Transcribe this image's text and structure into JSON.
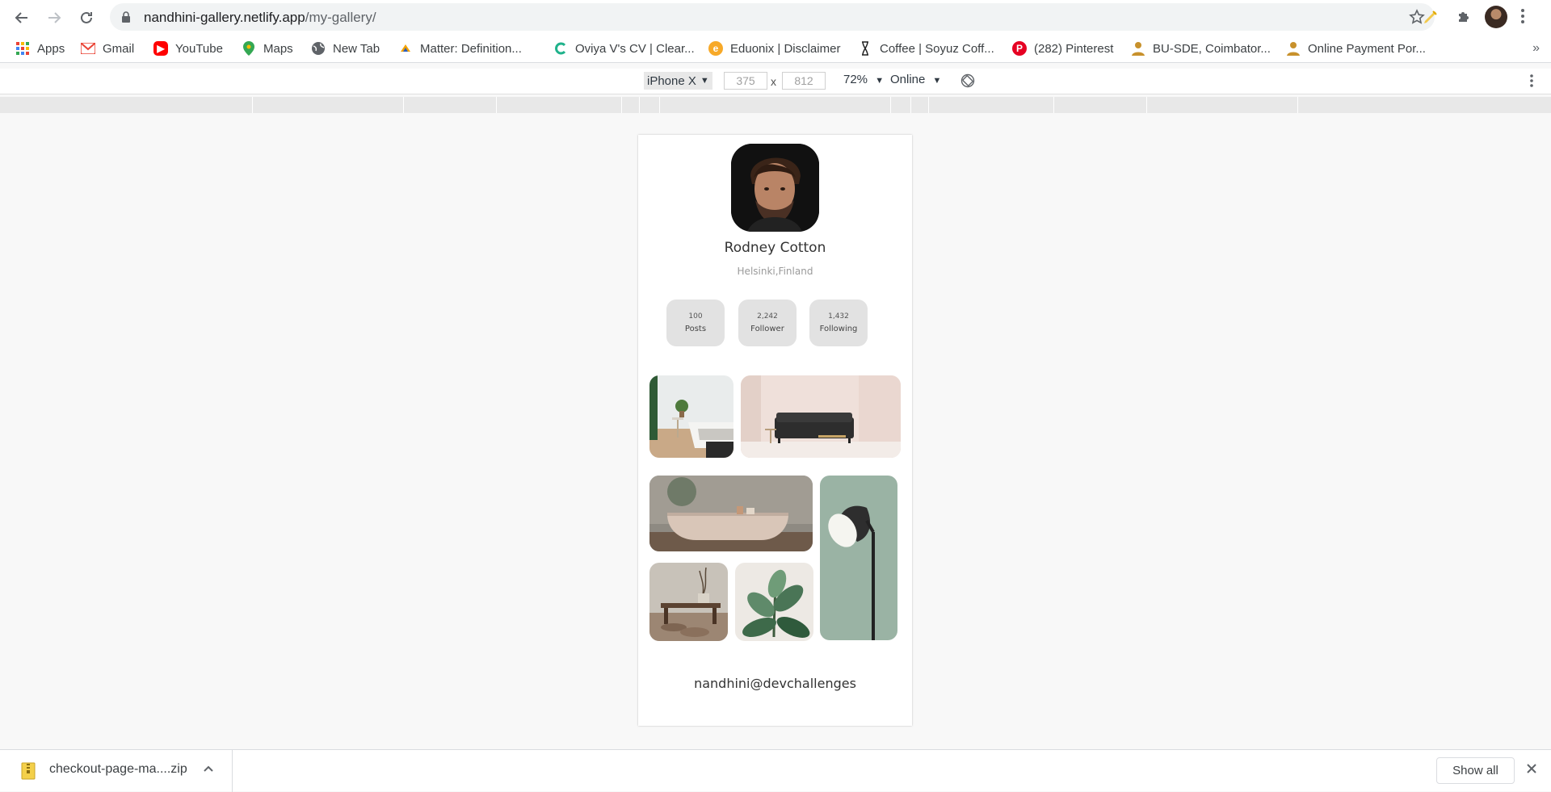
{
  "browser": {
    "url_host": "nandhini-gallery.netlify.app",
    "url_path": "/my-gallery/"
  },
  "bookmarks": [
    {
      "label": "Apps",
      "icon": "apps-grid-icon",
      "color": "#4285f4"
    },
    {
      "label": "Gmail",
      "icon": "gmail-icon",
      "color": "#ea4335"
    },
    {
      "label": "YouTube",
      "icon": "youtube-icon",
      "color": "#ff0000"
    },
    {
      "label": "Maps",
      "icon": "maps-pin-icon",
      "color": "#34a853"
    },
    {
      "label": "New Tab",
      "icon": "globe-icon",
      "color": "#5f6368"
    },
    {
      "label": "Matter: Definition...",
      "icon": "matter-site-icon",
      "color": "#f4a300"
    },
    {
      "label": "Oviya V's CV | Clear...",
      "icon": "cv-site-icon",
      "color": "#1fb28b"
    },
    {
      "label": "Eduonix | Disclaimer",
      "icon": "eduonix-icon",
      "color": "#f7a928"
    },
    {
      "label": "Coffee | Soyuz Coff...",
      "icon": "coffee-site-icon",
      "color": "#222222"
    },
    {
      "label": "(282) Pinterest",
      "icon": "pinterest-icon",
      "color": "#e60023"
    },
    {
      "label": "BU-SDE, Coimbator...",
      "icon": "university-icon",
      "color": "#c8912c"
    },
    {
      "label": "Online Payment Por...",
      "icon": "payment-site-icon",
      "color": "#c8912c"
    }
  ],
  "device_toolbar": {
    "device": "iPhone X",
    "width": "375",
    "height": "812",
    "dim_separator": "x",
    "zoom": "72%",
    "throttle": "Online"
  },
  "profile": {
    "name": "Rodney Cotton",
    "location": "Helsinki,Finland",
    "stats": [
      {
        "value": "100",
        "label": "Posts"
      },
      {
        "value": "2,242",
        "label": "Follower"
      },
      {
        "value": "1,432",
        "label": "Following"
      }
    ]
  },
  "gallery": [
    {
      "subject": "white bedroom with plant"
    },
    {
      "subject": "dark sofa in pink room"
    },
    {
      "subject": "stone bathtub"
    },
    {
      "subject": "sage green floor lamp"
    },
    {
      "subject": "wooden bench with pots"
    },
    {
      "subject": "rubber plant leaves"
    }
  ],
  "footer": {
    "credit": "nandhini@devchallenges"
  },
  "downloads": {
    "file_name": "checkout-page-ma....zip",
    "show_all": "Show all"
  }
}
